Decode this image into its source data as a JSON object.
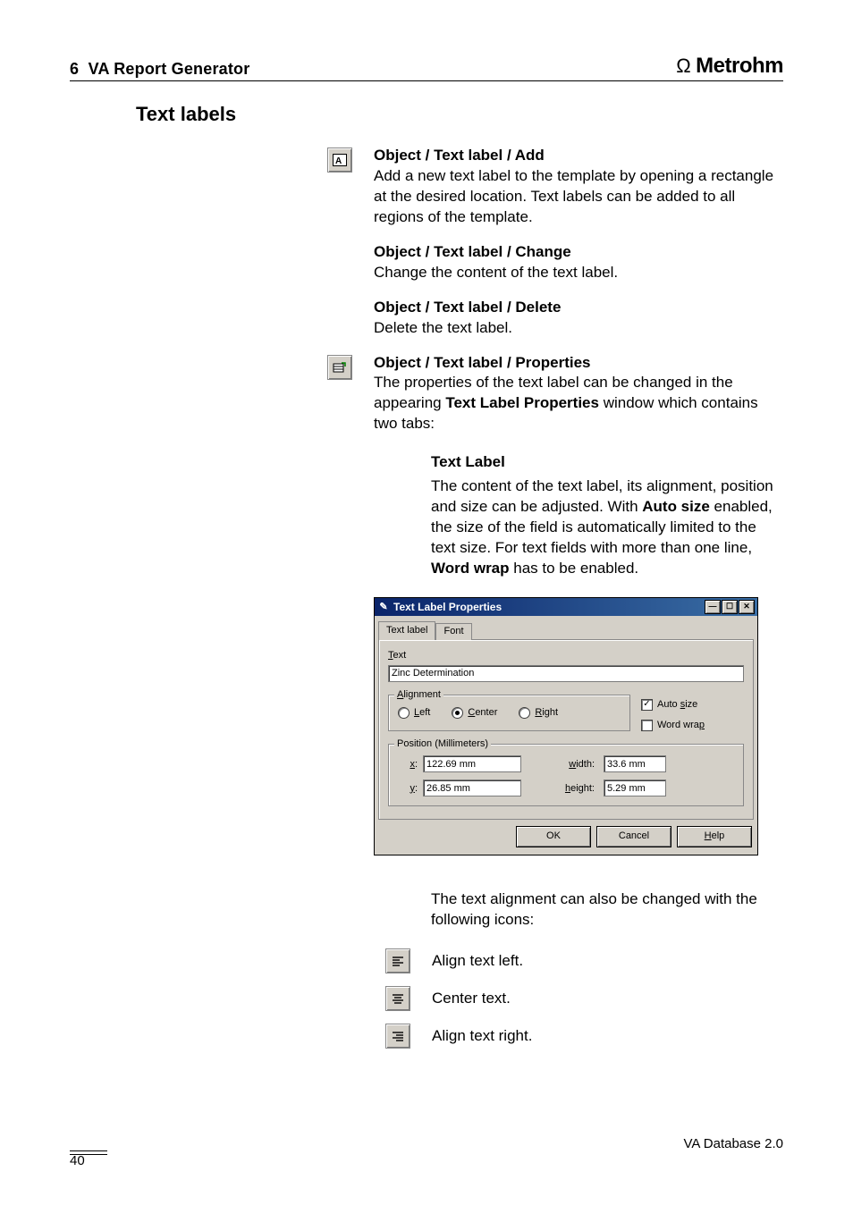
{
  "header": {
    "chapter_num": "6",
    "chapter_title": "VA Report Generator",
    "brand": "Metrohm"
  },
  "section": {
    "title": "Text labels"
  },
  "items": {
    "add": {
      "menu": "Object / Text label / Add",
      "text": "Add a new text label to the template by opening a rectangle at the desired location. Text labels can be added to all regions of the template."
    },
    "change": {
      "menu": "Object / Text label / Change",
      "text": "Change the content of the text label."
    },
    "delete": {
      "menu": "Object / Text label / Delete",
      "text": "Delete the text label."
    },
    "props": {
      "menu": "Object / Text label / Properties",
      "text_a": "The properties of the text label can be changed in the appearing ",
      "winname": "Text Label Properties",
      "text_b": " window which contains two tabs:"
    },
    "tab_textlabel": {
      "label": "Text Label",
      "p1a": "The content of the text label, its alignment, position and size can be adjusted. With ",
      "auto": "Auto size",
      "p1b": " enabled, the size of the field is automatically limited to the text size. For text fields with more than one line, ",
      "wrap": "Word wrap",
      "p1c": " has to be enabled."
    }
  },
  "dialog": {
    "title": "Text Label Properties",
    "tabs": {
      "textlabel": "Text label",
      "font": "Font"
    },
    "text_label": "Text",
    "text_value": "Zinc Determination",
    "alignment": {
      "title": "Alignment",
      "left": "Left",
      "center": "Center",
      "right": "Right"
    },
    "auto_size": "Auto size",
    "word_wrap": "Word wrap",
    "position": {
      "title": "Position (Millimeters)",
      "x": "x:",
      "y": "y:",
      "width": "width:",
      "height": "height:",
      "x_val": "122.69 mm",
      "y_val": "26.85 mm",
      "w_val": "33.6 mm",
      "h_val": "5.29 mm"
    },
    "buttons": {
      "ok": "OK",
      "cancel": "Cancel",
      "help": "Help"
    }
  },
  "post": {
    "intro": "The text alignment can also be changed with the following icons:",
    "left": "Align text left.",
    "center": "Center text.",
    "right": "Align text right."
  },
  "footer": {
    "product": "VA Database 2.0",
    "page": "40"
  }
}
